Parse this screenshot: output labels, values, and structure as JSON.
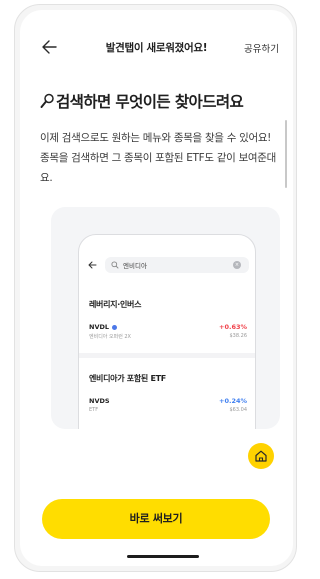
{
  "topbar": {
    "title": "발견탭이 새로워졌어요!",
    "share_label": "공유하기"
  },
  "headline": "검색하면 무엇이든 찾아드려요",
  "body_text": "이제 검색으로도 원하는 메뉴와 종목을 찾을 수 있어요! 종목을 검색하면 그 종목이 포함된 ETF도 같이 보여준대요.",
  "mock": {
    "search_query": "엔비디아",
    "section1_title": "레버리지·인버스",
    "section2_title": "엔비디아가 포함된 ETF",
    "rows": [
      {
        "ticker": "NVDL",
        "sub": "엔비디아 오퍼런 2X",
        "change": "+0.63%",
        "price": "$38.26",
        "change_color": "#f0414a"
      },
      {
        "ticker": "NVDS",
        "sub": "ETF",
        "change": "+0.24%",
        "price": "$63.04",
        "change_color": "#3f7ff0"
      }
    ]
  },
  "cta_label": "바로 써보기",
  "colors": {
    "accent": "#ffdd00",
    "up": "#f0414a",
    "blue": "#3f7ff0"
  },
  "icons": {
    "back": "arrow-left-icon",
    "headline": "magnifier-icon",
    "fab": "home-icon"
  }
}
